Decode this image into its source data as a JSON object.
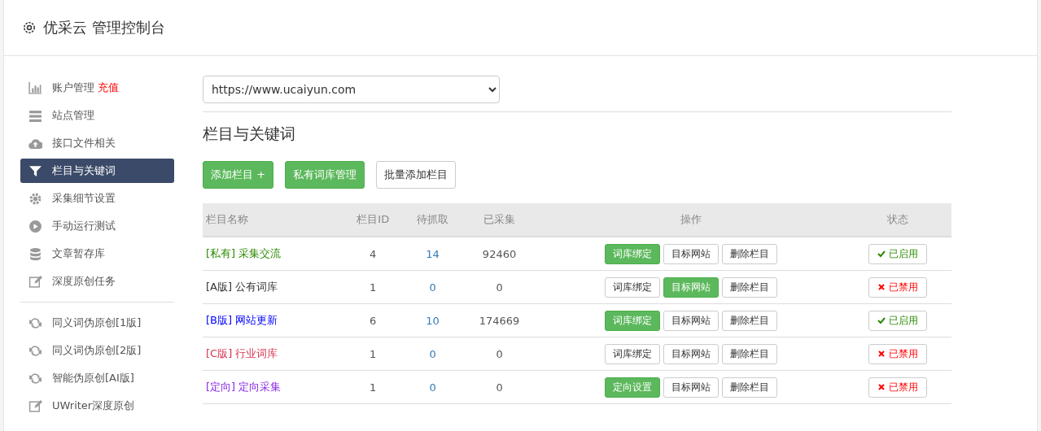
{
  "header": {
    "title": "优采云 管理控制台"
  },
  "sidebar": {
    "groups": [
      [
        {
          "label": "账户管理",
          "badge": "充值",
          "selected": false
        },
        {
          "label": "站点管理",
          "selected": false
        },
        {
          "label": "接口文件相关",
          "selected": false
        },
        {
          "label": "栏目与关键词",
          "selected": true
        },
        {
          "label": "采集细节设置",
          "selected": false
        },
        {
          "label": "手动运行测试",
          "selected": false
        },
        {
          "label": "文章暂存库",
          "selected": false
        },
        {
          "label": "深度原创任务",
          "selected": false
        }
      ],
      [
        {
          "label": "同义词伪原创[1版]",
          "selected": false
        },
        {
          "label": "同义词伪原创[2版]",
          "selected": false
        },
        {
          "label": "智能伪原创[AI版]",
          "selected": false
        },
        {
          "label": "UWriter深度原创",
          "selected": false
        }
      ]
    ]
  },
  "site_select": {
    "value": "https://www.ucaiyun.com"
  },
  "section_title": "栏目与关键词",
  "toolbar": [
    {
      "label": "添加栏目 +",
      "kind": "primary"
    },
    {
      "label": "私有词库管理",
      "kind": "primary"
    },
    {
      "label": "批量添加栏目",
      "kind": "default"
    }
  ],
  "table": {
    "columns": [
      "栏目名称",
      "栏目ID",
      "待抓取",
      "已采集",
      "操作",
      "状态"
    ],
    "rows": [
      {
        "tag": "[私有]",
        "name": "采集交流",
        "color": "#2b8a00",
        "id": "4",
        "pending": "14",
        "collected": "92460",
        "actions": [
          {
            "label": "词库绑定",
            "active": true
          },
          {
            "label": "目标网站",
            "active": false
          },
          {
            "label": "删除栏目",
            "active": false
          }
        ],
        "status": {
          "label": "已启用",
          "on": true
        }
      },
      {
        "tag": "[A版]",
        "name": "公有词库",
        "color": "#333333",
        "id": "1",
        "pending": "0",
        "collected": "0",
        "actions": [
          {
            "label": "词库绑定",
            "active": false
          },
          {
            "label": "目标网站",
            "active": true
          },
          {
            "label": "删除栏目",
            "active": false
          }
        ],
        "status": {
          "label": "已禁用",
          "on": false
        }
      },
      {
        "tag": "[B版]",
        "name": "网站更新",
        "color": "#0000ff",
        "id": "6",
        "pending": "10",
        "collected": "174669",
        "actions": [
          {
            "label": "词库绑定",
            "active": true
          },
          {
            "label": "目标网站",
            "active": false
          },
          {
            "label": "删除栏目",
            "active": false
          }
        ],
        "status": {
          "label": "已启用",
          "on": true
        }
      },
      {
        "tag": "[C版]",
        "name": "行业词库",
        "color": "#d6334f",
        "id": "1",
        "pending": "0",
        "collected": "0",
        "actions": [
          {
            "label": "词库绑定",
            "active": false
          },
          {
            "label": "目标网站",
            "active": false
          },
          {
            "label": "删除栏目",
            "active": false
          }
        ],
        "status": {
          "label": "已禁用",
          "on": false
        }
      },
      {
        "tag": "[定向]",
        "name": "定向采集",
        "color": "#8a2be2",
        "id": "1",
        "pending": "0",
        "collected": "0",
        "actions": [
          {
            "label": "定向设置",
            "active": true
          },
          {
            "label": "目标网站",
            "active": false
          },
          {
            "label": "删除栏目",
            "active": false
          }
        ],
        "status": {
          "label": "已禁用",
          "on": false
        }
      }
    ]
  }
}
